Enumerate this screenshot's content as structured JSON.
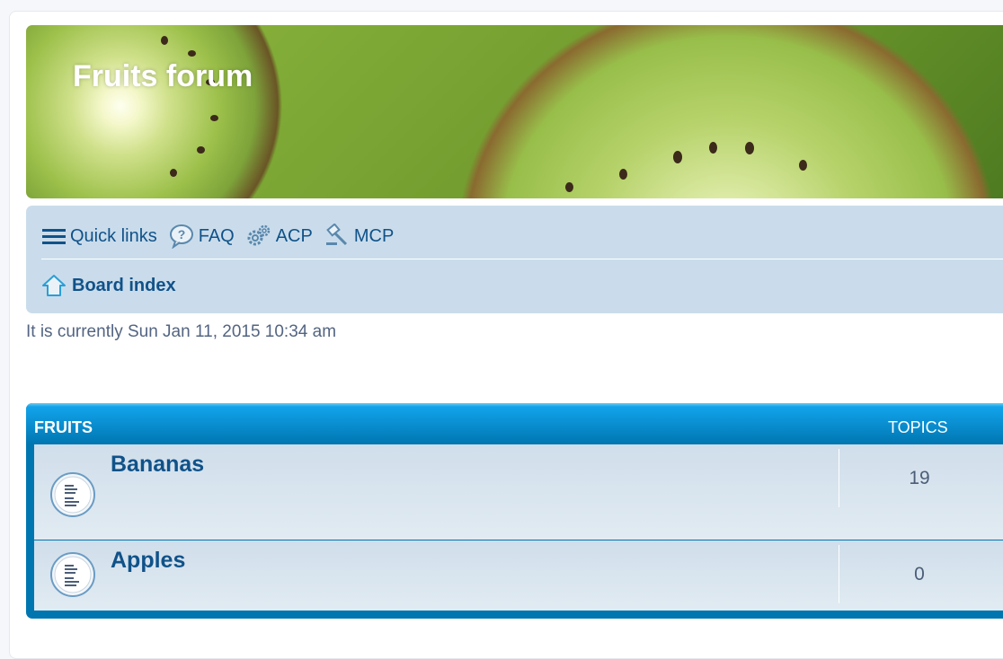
{
  "header": {
    "title": "Fruits forum"
  },
  "navbar": {
    "links": [
      {
        "label": "Quick links",
        "icon": "hamburger-menu-icon"
      },
      {
        "label": "FAQ",
        "icon": "help-bubble-icon"
      },
      {
        "label": "ACP",
        "icon": "gears-icon"
      },
      {
        "label": "MCP",
        "icon": "gavel-icon"
      }
    ],
    "breadcrumb": {
      "label": "Board index",
      "icon": "home-icon"
    }
  },
  "current_time": "It is currently Sun Jan 11, 2015 10:34 am",
  "category": {
    "title": "FRUITS",
    "topics_header": "TOPICS",
    "forums": [
      {
        "name": "Bananas",
        "topics": "19",
        "icon": "forum-read-icon"
      },
      {
        "name": "Apples",
        "topics": "0",
        "icon": "forum-read-icon"
      }
    ]
  },
  "colors": {
    "link": "#105289",
    "navbar": "#cadceb",
    "category_header": "#0076b1"
  }
}
